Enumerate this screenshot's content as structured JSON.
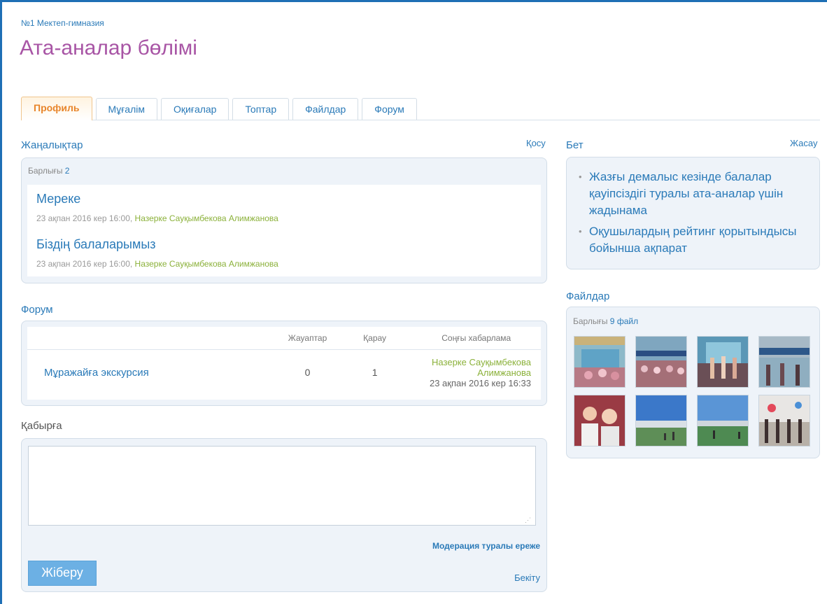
{
  "breadcrumb": "№1 Мектеп-гимназия",
  "page_title": "Ата-аналар бөлімі",
  "tabs": [
    {
      "label": "Профиль",
      "active": true
    },
    {
      "label": "Мұғалім",
      "active": false
    },
    {
      "label": "Оқиғалар",
      "active": false
    },
    {
      "label": "Топтар",
      "active": false
    },
    {
      "label": "Файлдар",
      "active": false
    },
    {
      "label": "Форум",
      "active": false
    }
  ],
  "news": {
    "title": "Жаңалықтар",
    "action": "Қосу",
    "count_label": "Барлығы",
    "count": "2",
    "items": [
      {
        "title": "Мереке",
        "meta": "23 ақпан 2016 кер 16:00,",
        "author": "Назерке Сауқымбекова Алимжанова"
      },
      {
        "title": "Біздің балаларымыз",
        "meta": "23 ақпан 2016 кер 16:00,",
        "author": "Назерке Сауқымбекова Алимжанова"
      }
    ]
  },
  "forum": {
    "title": "Форум",
    "headers": {
      "replies": "Жауаптар",
      "views": "Қарау",
      "last": "Соңғы хабарлама"
    },
    "rows": [
      {
        "topic": "Мұражайға экскурсия",
        "replies": "0",
        "views": "1",
        "last_author": "Назерке Сауқымбекова Алимжанова",
        "last_date": "23 ақпан 2016 кер 16:33"
      }
    ]
  },
  "wall": {
    "title": "Қабырға",
    "textarea_value": "",
    "moderation_link": "Модерация туралы ереже",
    "send_button": "Жіберу",
    "pin_link": "Бекіту"
  },
  "page_box": {
    "title": "Бет",
    "action": "Жасау",
    "links": [
      "Жазғы демалыс кезінде балалар қауіпсіздігі туралы ата-аналар үшін жадынама",
      "Оқушылардың рейтинг қорытындысы бойынша ақпарат"
    ]
  },
  "files": {
    "title": "Файлдар",
    "count_label": "Барлығы",
    "count": "9",
    "count_unit": "файл",
    "thumbs": [
      "photo-icon",
      "photo-icon",
      "photo-icon",
      "photo-icon",
      "photo-icon",
      "photo-icon",
      "photo-icon",
      "photo-icon"
    ]
  },
  "colors": {
    "accent": "#1e6fb5",
    "link": "#2a7ab8",
    "title": "#a855a5",
    "active_tab": "#e8852a",
    "author": "#8bb13a",
    "box_bg": "#eef3f9",
    "button": "#6cb0e4"
  }
}
